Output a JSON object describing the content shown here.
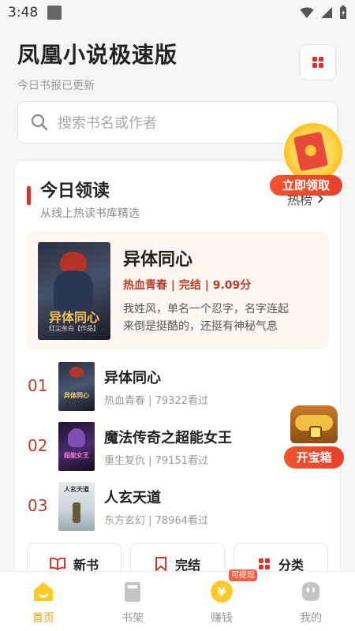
{
  "status": {
    "time": "3:48"
  },
  "header": {
    "title": "凤凰小说极速版",
    "subtitle": "今日书报已更新"
  },
  "search": {
    "placeholder": "搜索书名或作者"
  },
  "section": {
    "title": "今日领读",
    "subtitle": "从线上热读书库精选",
    "hot_label": "热榜"
  },
  "featured": {
    "title": "异体同心",
    "tags": "热血青春 | 完结 | 9.09分",
    "desc_line1": "我姓风，单名一个忍字，名字连起",
    "desc_line2": "来倒是挺酷的，还挺有神秘气息",
    "cover_title": "异体同心",
    "cover_author": "红尘亲白【作品】"
  },
  "claim": {
    "label": "立即领取"
  },
  "treasure": {
    "label": "开宝箱"
  },
  "ranking": [
    {
      "rank": "01",
      "title": "异体同心",
      "meta": "热血青春 | 79322看过",
      "cover_text": "异体同心"
    },
    {
      "rank": "02",
      "title": "魔法传奇之超能女王",
      "meta": "重生复仇 | 79151看过",
      "cover_text": "超能女王"
    },
    {
      "rank": "03",
      "title": "人玄天道",
      "meta": "东方玄幻 | 78964看过",
      "cover_text": "人玄天道"
    }
  ],
  "quick": {
    "new": "新书",
    "finished": "完结",
    "category": "分类"
  },
  "tabs": {
    "home": "首页",
    "shelf": "书架",
    "earn": "赚钱",
    "mine": "我的",
    "withdraw_tag": "可提现"
  },
  "colors": {
    "accent": "#d9342b",
    "active_tab": "#f0a300"
  }
}
